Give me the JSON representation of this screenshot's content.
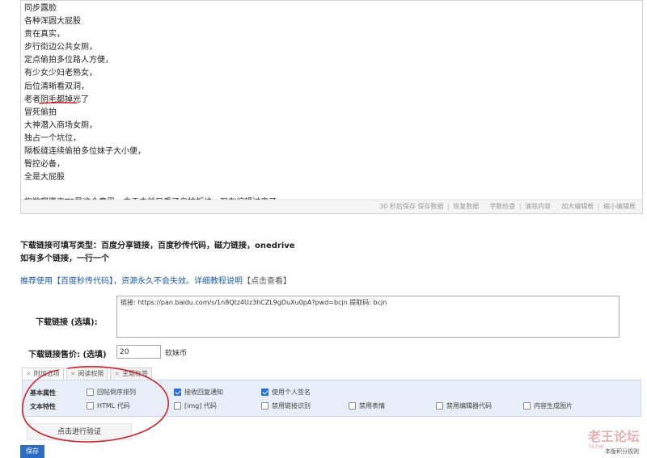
{
  "editor": {
    "lines": [
      "同步露脸",
      "各种浑圆大屁股",
      "贵在真实，",
      "步行街边公共女厕，",
      "定点偷拍多位路人方便，",
      "有少女少妇老熟女，",
      "后位清晰看双洞，",
      "老者阴毛都掉光了",
      "冒死偷拍",
      "大神潜入商场女厕，",
      "独占一个坑位，",
      "隔板缝连续偷拍多位妹子大小便，",
      "臀控必备，",
      "全是大屁股"
    ],
    "last_line": "抱歉啊原来TP是这个意思，由于之前只看了自拍板块，现在编辑过来了",
    "footer": {
      "autosave": "30 秒后保存",
      "save_data": "保存数据",
      "restore_data": "恢复数据",
      "word_check": "字数检查",
      "clear_content": "清除内容",
      "enlarge": "加大编辑框",
      "shrink": "缩小编辑框",
      "sep": "|"
    },
    "mark_color": "#d2232a"
  },
  "hints": {
    "line1": "下载链接可填写类型：百度分享链接，百度秒传代码，磁力链接，onedrive",
    "line2": "如有多个链接，一行一个",
    "recommend": "推荐使用【百度秒传代码】，资源永久不会失效。详细教程说明",
    "recommend_link": "【点击查看】"
  },
  "download": {
    "label": "下载链接 (选填):",
    "value": "链接: https://pan.baidu.com/s/1n8Qtz4Uz3hCZL9gDuXu0pA?pwd=bcjn 提取码: bcjn"
  },
  "price": {
    "label": "下载链接售价:  (选填)",
    "value": "20",
    "unit": "软妹币"
  },
  "tabs": [
    {
      "label": "附加选项"
    },
    {
      "label": "阅读权限"
    },
    {
      "label": "主题标签"
    }
  ],
  "tab_close": "×",
  "options": {
    "row1_label": "基本属性",
    "row2_label": "文本特性",
    "reverse_order": "回帖倒序排列",
    "receive_reply": "接收回复通知",
    "use_signature": "使用个人签名",
    "html_code": "HTML 代码",
    "img_code": "[img] 代码",
    "disable_link": "禁用链接识别",
    "disable_emoji": "禁用表情",
    "disable_editor_code": "禁用编辑器代码",
    "content_image": "内容生成图片"
  },
  "buttons": {
    "verify": "点击进行验证",
    "save": "保存"
  },
  "watermark": {
    "title": "老王论坛",
    "sub": "laow",
    "rules": "本版积分规则"
  },
  "accent": "#2d6bc4",
  "annotation_color": "#d2232a"
}
